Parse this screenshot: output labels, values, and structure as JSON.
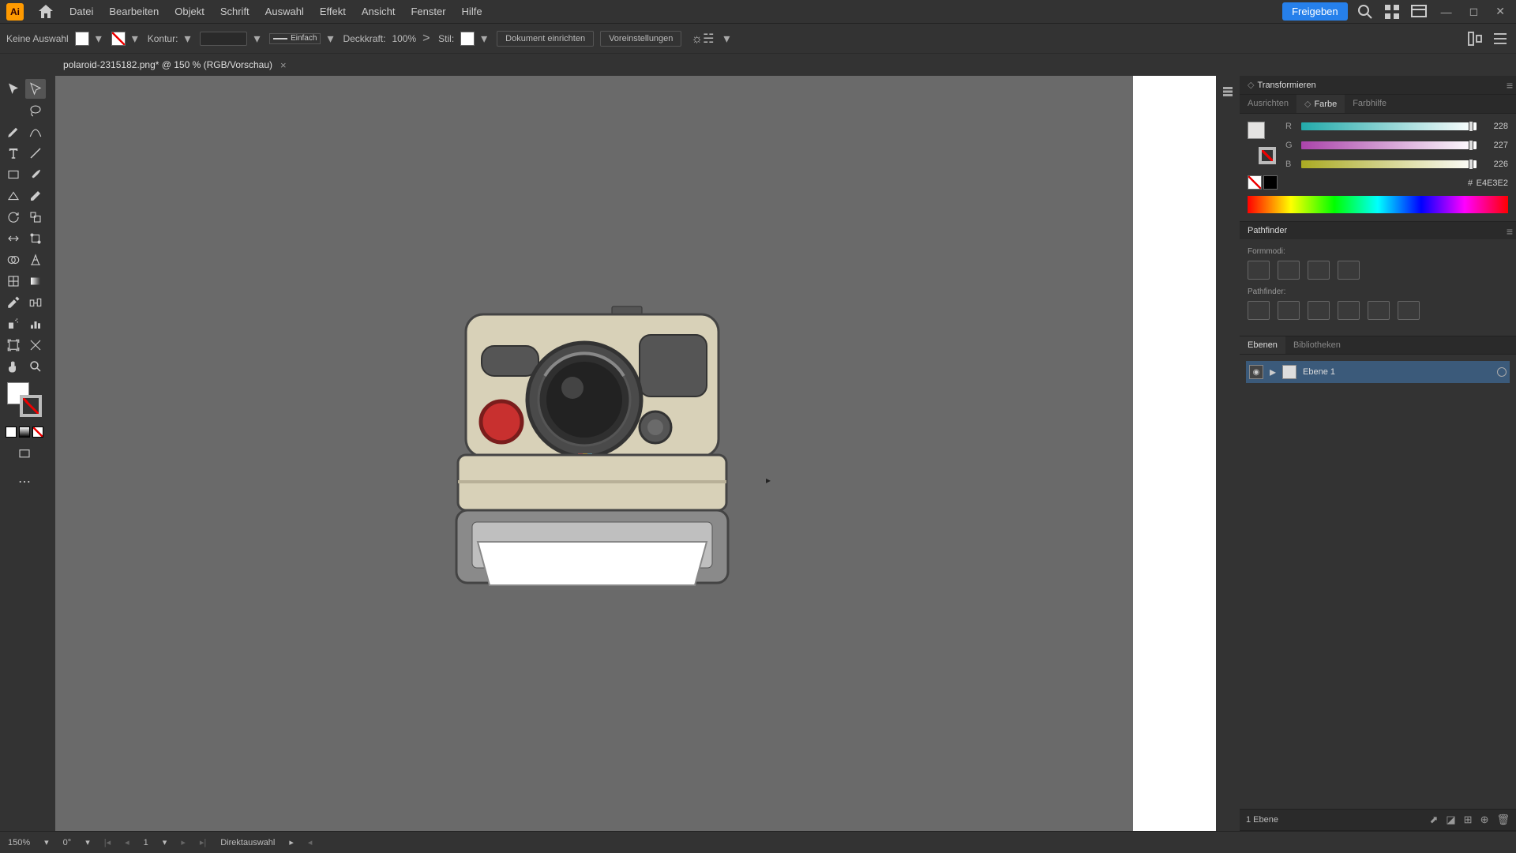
{
  "app": {
    "logo_text": "Ai"
  },
  "menu": {
    "file": "Datei",
    "edit": "Bearbeiten",
    "object": "Objekt",
    "type": "Schrift",
    "select": "Auswahl",
    "effect": "Effekt",
    "view": "Ansicht",
    "window": "Fenster",
    "help": "Hilfe"
  },
  "menubar_right": {
    "share": "Freigeben"
  },
  "options": {
    "no_selection": "Keine Auswahl",
    "stroke_label": "Kontur:",
    "stroke_style": "Einfach",
    "opacity_label": "Deckkraft:",
    "opacity_value": "100%",
    "style_label": "Stil:",
    "doc_setup": "Dokument einrichten",
    "presets": "Voreinstellungen"
  },
  "tab": {
    "title": "polaroid-2315182.png* @ 150 % (RGB/Vorschau)",
    "close": "×"
  },
  "panels": {
    "transform": {
      "title": "Transformieren"
    },
    "align": "Ausrichten",
    "color": {
      "title": "Farbe",
      "guide": "Farbhilfe",
      "r_label": "R",
      "r_val": "228",
      "g_label": "G",
      "g_val": "227",
      "b_label": "B",
      "b_val": "226",
      "hex_prefix": "#",
      "hex": "E4E3E2"
    },
    "pathfinder": {
      "title": "Pathfinder",
      "shape_modes": "Formmodi:",
      "pathfinder_label": "Pathfinder:"
    },
    "layers": {
      "title": "Ebenen",
      "libraries": "Bibliotheken",
      "layer1": "Ebene 1",
      "count": "1 Ebene"
    }
  },
  "status": {
    "zoom": "150%",
    "rotate": "0°",
    "artboard": "1",
    "tool": "Direktauswahl"
  }
}
